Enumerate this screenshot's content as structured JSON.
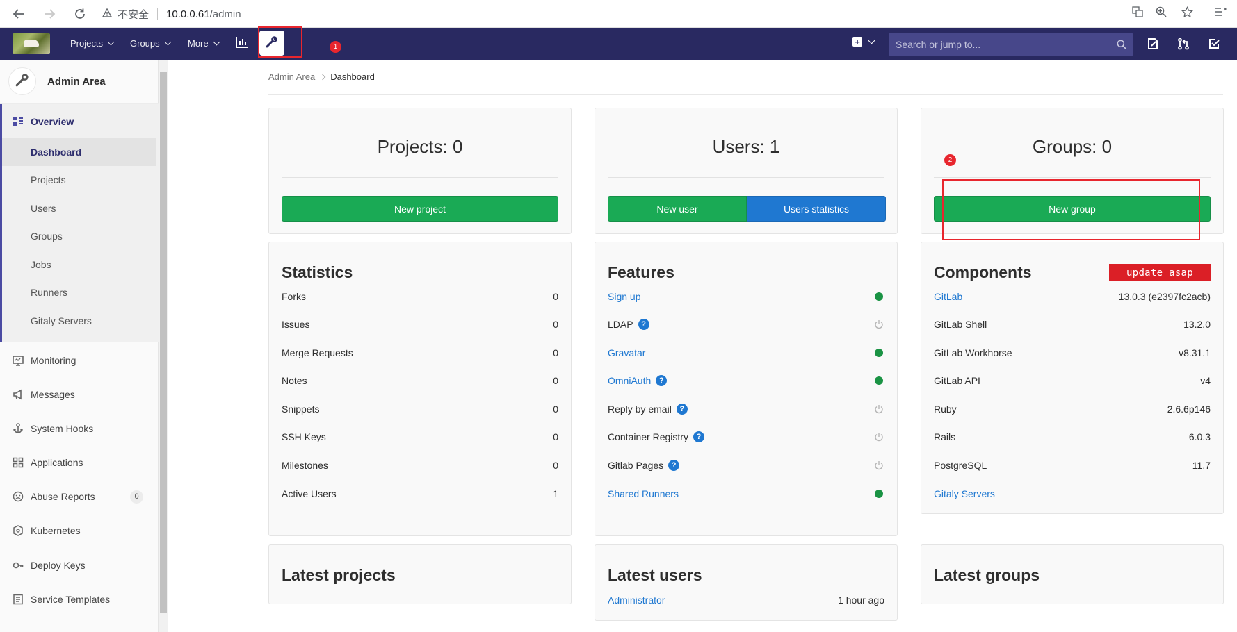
{
  "browser": {
    "insecure_label": "不安全",
    "url_host": "10.0.0.61",
    "url_path": "/admin"
  },
  "topnav": {
    "projects": "Projects",
    "groups": "Groups",
    "more": "More",
    "search_placeholder": "Search or jump to..."
  },
  "annotations": {
    "one": "1",
    "two": "2",
    "color": "#e8262e"
  },
  "sidebar": {
    "title": "Admin Area",
    "overview": "Overview",
    "sub_items": [
      "Dashboard",
      "Projects",
      "Users",
      "Groups",
      "Jobs",
      "Runners",
      "Gitaly Servers"
    ],
    "items": [
      {
        "label": "Monitoring",
        "icon": "monitor-icon"
      },
      {
        "label": "Messages",
        "icon": "megaphone-icon"
      },
      {
        "label": "System Hooks",
        "icon": "hook-icon"
      },
      {
        "label": "Applications",
        "icon": "applications-icon"
      },
      {
        "label": "Abuse Reports",
        "icon": "abuse-icon",
        "count": "0"
      },
      {
        "label": "Kubernetes",
        "icon": "kubernetes-icon"
      },
      {
        "label": "Deploy Keys",
        "icon": "key-icon"
      },
      {
        "label": "Service Templates",
        "icon": "template-icon"
      }
    ]
  },
  "breadcrumb": {
    "root": "Admin Area",
    "current": "Dashboard"
  },
  "cards": {
    "projects": {
      "title": "Projects: 0",
      "button": "New project"
    },
    "users": {
      "title": "Users: 1",
      "button_new": "New user",
      "button_stats": "Users statistics"
    },
    "groups": {
      "title": "Groups: 0",
      "button": "New group"
    }
  },
  "statistics": {
    "title": "Statistics",
    "rows": [
      {
        "label": "Forks",
        "value": "0"
      },
      {
        "label": "Issues",
        "value": "0"
      },
      {
        "label": "Merge Requests",
        "value": "0"
      },
      {
        "label": "Notes",
        "value": "0"
      },
      {
        "label": "Snippets",
        "value": "0"
      },
      {
        "label": "SSH Keys",
        "value": "0"
      },
      {
        "label": "Milestones",
        "value": "0"
      },
      {
        "label": "Active Users",
        "value": "1"
      }
    ]
  },
  "features": {
    "title": "Features",
    "rows": [
      {
        "label": "Sign up",
        "link": true,
        "help": false,
        "status": "on"
      },
      {
        "label": "LDAP",
        "link": false,
        "help": true,
        "status": "off"
      },
      {
        "label": "Gravatar",
        "link": true,
        "help": false,
        "status": "on"
      },
      {
        "label": "OmniAuth",
        "link": true,
        "help": true,
        "status": "on"
      },
      {
        "label": "Reply by email",
        "link": false,
        "help": true,
        "status": "off"
      },
      {
        "label": "Container Registry",
        "link": false,
        "help": true,
        "status": "off"
      },
      {
        "label": "Gitlab Pages",
        "link": false,
        "help": true,
        "status": "off"
      },
      {
        "label": "Shared Runners",
        "link": true,
        "help": false,
        "status": "on"
      }
    ]
  },
  "components": {
    "title": "Components",
    "badge": "update asap",
    "rows": [
      {
        "label": "GitLab",
        "value": "13.0.3 (e2397fc2acb)",
        "link": true
      },
      {
        "label": "GitLab Shell",
        "value": "13.2.0",
        "link": false
      },
      {
        "label": "GitLab Workhorse",
        "value": "v8.31.1",
        "link": false
      },
      {
        "label": "GitLab API",
        "value": "v4",
        "link": false
      },
      {
        "label": "Ruby",
        "value": "2.6.6p146",
        "link": false
      },
      {
        "label": "Rails",
        "value": "6.0.3",
        "link": false
      },
      {
        "label": "PostgreSQL",
        "value": "11.7",
        "link": false
      },
      {
        "label": "Gitaly Servers",
        "value": "",
        "link": true
      }
    ]
  },
  "latest": {
    "projects_title": "Latest projects",
    "users_title": "Latest users",
    "groups_title": "Latest groups",
    "user_name": "Administrator",
    "user_time": "1 hour ago"
  }
}
